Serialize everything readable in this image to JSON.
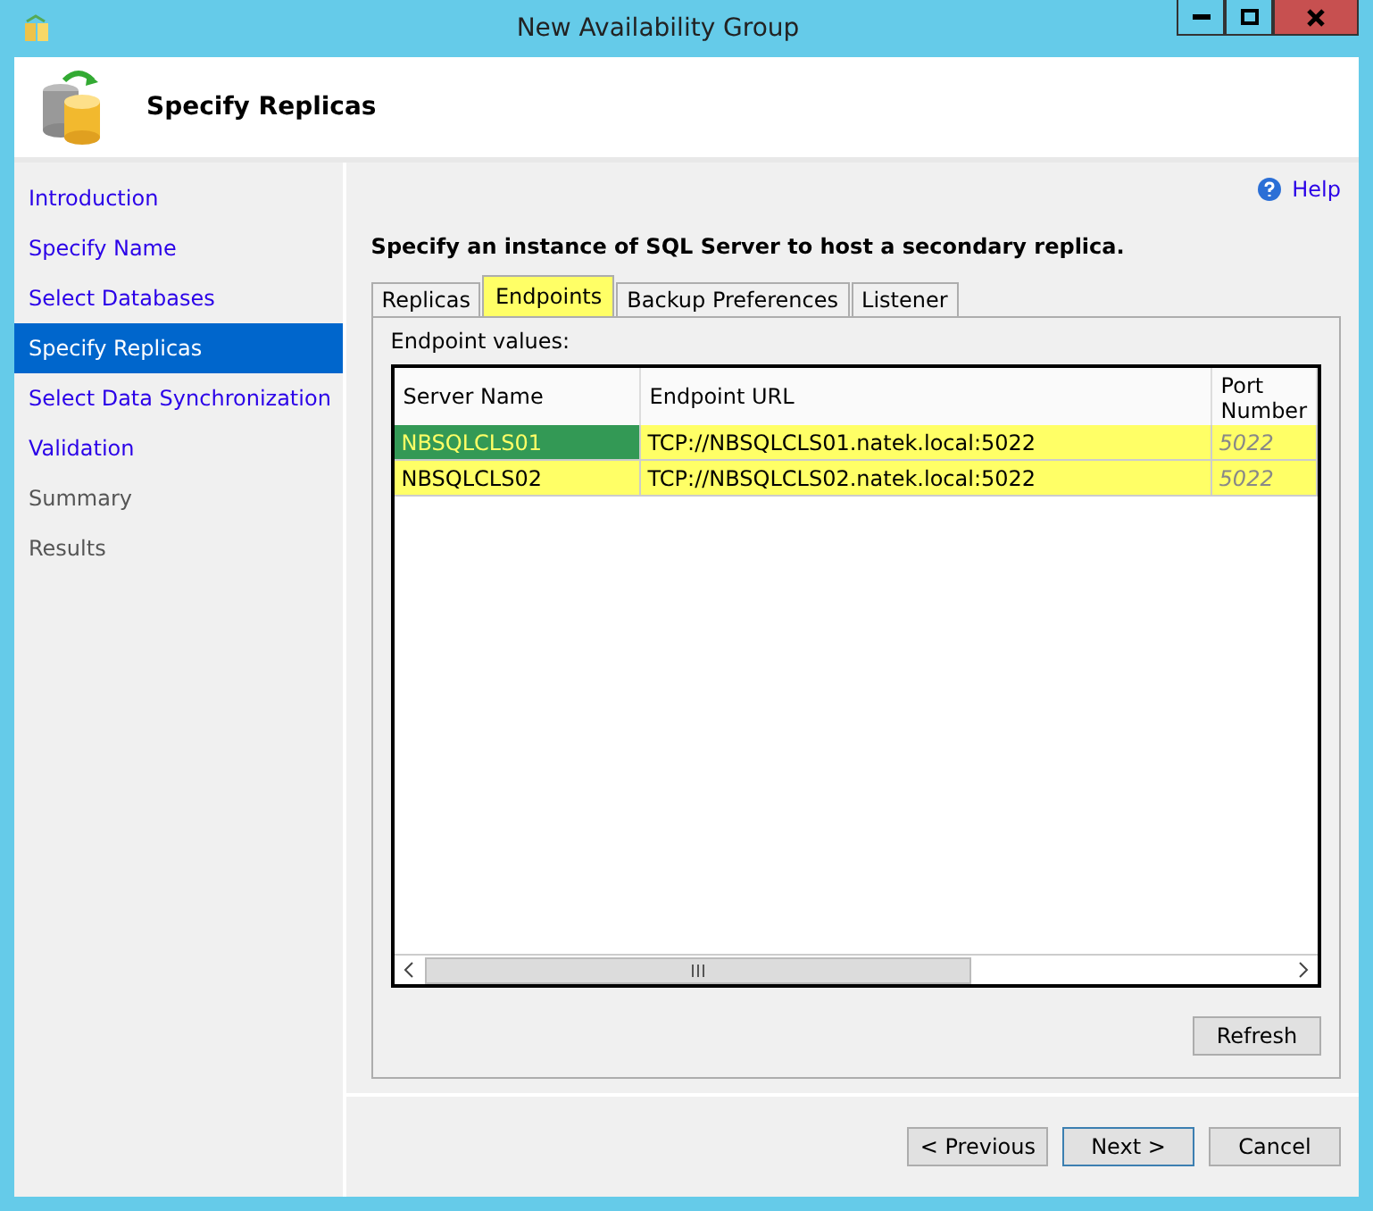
{
  "window": {
    "title": "New Availability Group"
  },
  "header": {
    "title": "Specify Replicas"
  },
  "sidebar": {
    "items": [
      {
        "label": "Introduction",
        "selected": false,
        "disabled": false
      },
      {
        "label": "Specify Name",
        "selected": false,
        "disabled": false
      },
      {
        "label": "Select Databases",
        "selected": false,
        "disabled": false
      },
      {
        "label": "Specify Replicas",
        "selected": true,
        "disabled": false
      },
      {
        "label": "Select Data Synchronization",
        "selected": false,
        "disabled": false
      },
      {
        "label": "Validation",
        "selected": false,
        "disabled": false
      },
      {
        "label": "Summary",
        "selected": false,
        "disabled": true
      },
      {
        "label": "Results",
        "selected": false,
        "disabled": true
      }
    ]
  },
  "help": "Help",
  "instruction": "Specify an instance of SQL Server to host a secondary replica.",
  "tabs": [
    {
      "label": "Replicas",
      "selected": false,
      "highlighted": false
    },
    {
      "label": "Endpoints",
      "selected": true,
      "highlighted": true
    },
    {
      "label": "Backup Preferences",
      "selected": false,
      "highlighted": false
    },
    {
      "label": "Listener",
      "selected": false,
      "highlighted": false
    }
  ],
  "group_label": "Endpoint values:",
  "table": {
    "columns": [
      "Server Name",
      "Endpoint URL",
      "Port Number"
    ],
    "rows": [
      {
        "cells": [
          "NBSQLCLS01",
          "TCP://NBSQLCLS01.natek.local:5022",
          "5022"
        ],
        "selected": true,
        "highlighted": true
      },
      {
        "cells": [
          "NBSQLCLS02",
          "TCP://NBSQLCLS02.natek.local:5022",
          "5022"
        ],
        "selected": false,
        "highlighted": true
      }
    ]
  },
  "refresh": "Refresh",
  "buttons": [
    "< Previous",
    "Next >",
    "Cancel"
  ]
}
